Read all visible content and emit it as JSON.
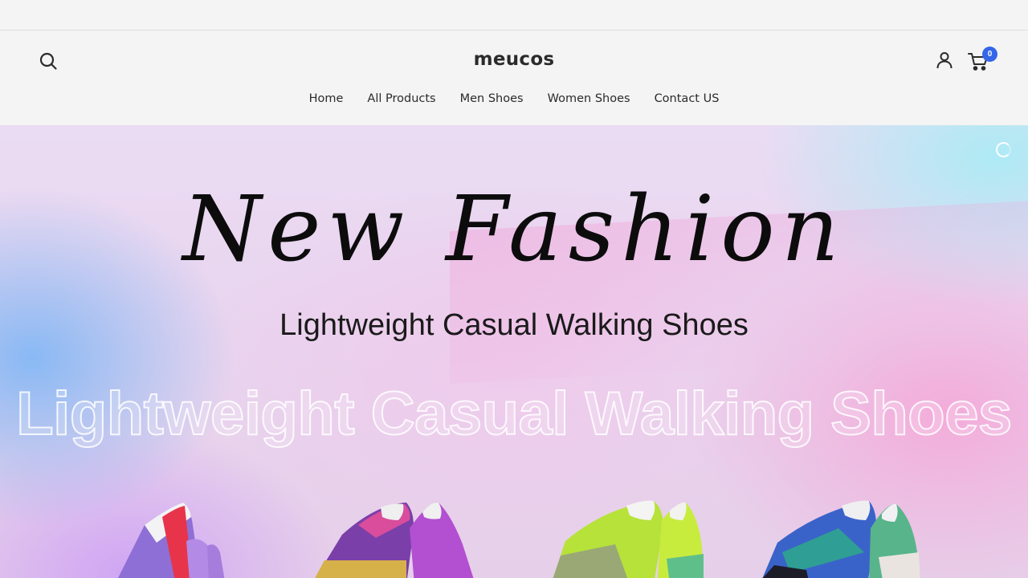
{
  "store": {
    "name": "meucos"
  },
  "header": {
    "icons": [
      "search-icon",
      "account-icon",
      "cart-icon"
    ],
    "cart_count": "0",
    "badge_color": "#3466e8"
  },
  "nav": {
    "items": [
      {
        "label": "Home"
      },
      {
        "label": "All Products"
      },
      {
        "label": "Men Shoes"
      },
      {
        "label": "Women Shoes"
      },
      {
        "label": "Contact US"
      }
    ]
  },
  "hero": {
    "headline": "New Fashion",
    "subheadline": "Lightweight Casual Walking Shoes",
    "watermark_text": "Lightweight Casual Walking Shoes",
    "products": [
      "red-white-purple-slip-on",
      "purple-pink-yellow-slip-on",
      "lime-green-slip-on",
      "blue-green-white-slip-on"
    ]
  }
}
